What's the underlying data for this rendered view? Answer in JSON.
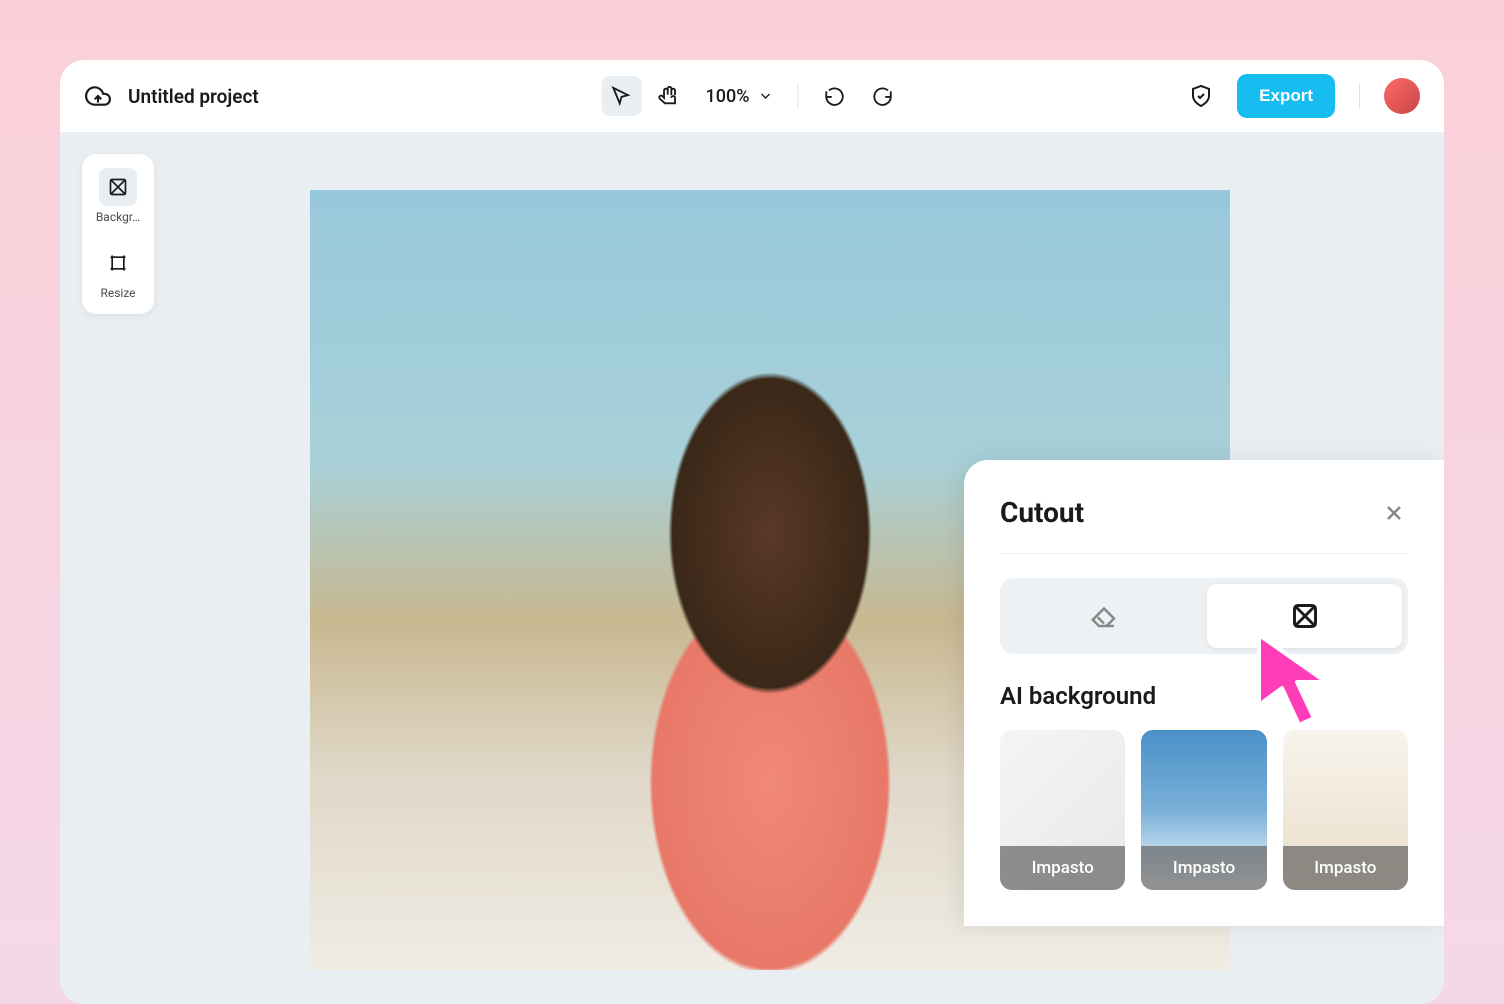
{
  "header": {
    "project_title": "Untitled project",
    "zoom_level": "100%",
    "export_label": "Export"
  },
  "sidebar": {
    "items": [
      {
        "label": "Backgr…",
        "icon": "background-icon"
      },
      {
        "label": "Resize",
        "icon": "resize-icon"
      }
    ]
  },
  "cutout_panel": {
    "title": "Cutout",
    "section_title": "AI background",
    "tabs": [
      {
        "icon": "eraser-icon",
        "active": false
      },
      {
        "icon": "pattern-icon",
        "active": true
      }
    ],
    "backgrounds": [
      {
        "label": "Impasto"
      },
      {
        "label": "Impasto"
      },
      {
        "label": "Impasto"
      }
    ]
  }
}
